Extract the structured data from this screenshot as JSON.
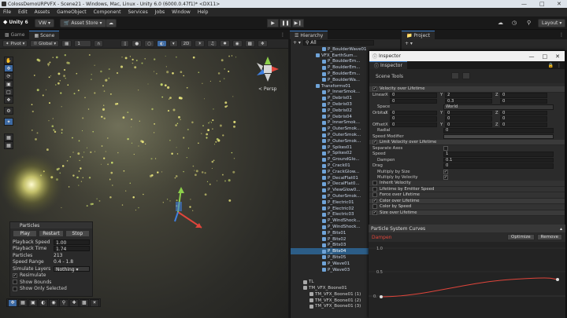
{
  "window": {
    "title": "ColossDemoURPVFX - Scene21 - Windows, Mac, Linux - Unity 6.0 (6000.0.47f1)* <DX11>"
  },
  "menu": [
    "File",
    "Edit",
    "Assets",
    "GameObject",
    "Component",
    "Services",
    "Jobs",
    "Window",
    "Help"
  ],
  "toolbar": {
    "unity_label": "Unity 6",
    "account": "VW",
    "asset_store": "Asset Store",
    "layout": "Layout"
  },
  "tabs": {
    "game": "Game",
    "scene": "Scene",
    "hierarchy": "Hierarchy",
    "project": "Project"
  },
  "scenebar": {
    "pivot": "Pivot",
    "global": "Global",
    "snap": "1",
    "zoom": "2D",
    "persp": "< Persp"
  },
  "particles_panel": {
    "title": "Particles",
    "play": "Play",
    "restart": "Restart",
    "stop": "Stop",
    "rows": [
      {
        "label": "Playback Speed",
        "value": "1.00"
      },
      {
        "label": "Playback Time",
        "value": "1.74"
      },
      {
        "label": "Particles",
        "value": "213"
      },
      {
        "label": "Speed Range",
        "value": "0.4 - 1.8"
      },
      {
        "label": "Simulate Layers",
        "value": "Nothing"
      }
    ],
    "checks": [
      {
        "label": "Resimulate",
        "checked": true
      },
      {
        "label": "Show Bounds",
        "checked": false
      },
      {
        "label": "Show Only Selected",
        "checked": false
      }
    ]
  },
  "hierarchy": {
    "search_placeholder": "All",
    "items": [
      {
        "name": "P_BoulderWave01",
        "indent": 4,
        "type": "prefab"
      },
      {
        "name": "VFX_EarthSum...",
        "indent": 3,
        "type": "prefab"
      },
      {
        "name": "P_BoulderEm...",
        "indent": 4,
        "type": "prefab"
      },
      {
        "name": "P_BoulderEm...",
        "indent": 4,
        "type": "prefab"
      },
      {
        "name": "P_BoulderEm...",
        "indent": 4,
        "type": "prefab"
      },
      {
        "name": "P_BoulderWa...",
        "indent": 4,
        "type": "prefab"
      },
      {
        "name": "Transforms01",
        "indent": 3,
        "type": "prefab"
      },
      {
        "name": "P_InnerSmok...",
        "indent": 4,
        "type": "prefab"
      },
      {
        "name": "P_Debris01",
        "indent": 4,
        "type": "prefab"
      },
      {
        "name": "P_Debris03",
        "indent": 4,
        "type": "prefab"
      },
      {
        "name": "P_Debris02",
        "indent": 4,
        "type": "prefab"
      },
      {
        "name": "P_Debris04",
        "indent": 4,
        "type": "prefab"
      },
      {
        "name": "P_InnerSmok...",
        "indent": 4,
        "type": "prefab"
      },
      {
        "name": "P_OuterSmok...",
        "indent": 4,
        "type": "prefab"
      },
      {
        "name": "P_OuterSmok...",
        "indent": 4,
        "type": "prefab"
      },
      {
        "name": "P_OuterSmok...",
        "indent": 4,
        "type": "prefab"
      },
      {
        "name": "P_Spikes01",
        "indent": 4,
        "type": "prefab"
      },
      {
        "name": "P_Spikes02",
        "indent": 4,
        "type": "prefab"
      },
      {
        "name": "P_GroundGlo...",
        "indent": 4,
        "type": "prefab"
      },
      {
        "name": "P_Crack01",
        "indent": 4,
        "type": "prefab"
      },
      {
        "name": "P_CrackGlow...",
        "indent": 4,
        "type": "prefab"
      },
      {
        "name": "P_DecalFlat01",
        "indent": 4,
        "type": "prefab"
      },
      {
        "name": "P_DecalFlat0...",
        "indent": 4,
        "type": "prefab"
      },
      {
        "name": "P_ViewGlow0...",
        "indent": 4,
        "type": "prefab"
      },
      {
        "name": "P_OuterSmok...",
        "indent": 4,
        "type": "prefab"
      },
      {
        "name": "P_Electric01",
        "indent": 4,
        "type": "prefab"
      },
      {
        "name": "P_Electric02",
        "indent": 4,
        "type": "prefab"
      },
      {
        "name": "P_Electric03",
        "indent": 4,
        "type": "prefab"
      },
      {
        "name": "P_WindShock...",
        "indent": 4,
        "type": "prefab"
      },
      {
        "name": "P_WindShock...",
        "indent": 4,
        "type": "prefab"
      },
      {
        "name": "P_Bits01",
        "indent": 4,
        "type": "prefab"
      },
      {
        "name": "P_Bits02",
        "indent": 4,
        "type": "prefab"
      },
      {
        "name": "P_Bits03",
        "indent": 4,
        "type": "prefab"
      },
      {
        "name": "P_Bits04",
        "indent": 4,
        "type": "prefab",
        "selected": true
      },
      {
        "name": "P_Bits05",
        "indent": 4,
        "type": "prefab"
      },
      {
        "name": "P_Wave01",
        "indent": 4,
        "type": "prefab"
      },
      {
        "name": "P_Wave03",
        "indent": 4,
        "type": "prefab"
      },
      {
        "name": "",
        "indent": 0,
        "type": "gap"
      },
      {
        "name": "TL",
        "indent": 1,
        "type": "object"
      },
      {
        "name": "TM_VFX_Boone01",
        "indent": 1,
        "type": "object"
      },
      {
        "name": "TM_VFX_Boone01 (1)",
        "indent": 2,
        "type": "object"
      },
      {
        "name": "TM_VFX_Boone01 (2)",
        "indent": 2,
        "type": "object"
      },
      {
        "name": "TM_VFX_Boone01 (3)",
        "indent": 2,
        "type": "object"
      }
    ]
  },
  "inspector": {
    "window_title": "Inspector",
    "tab": "Inspector",
    "scene_tools": "Scene Tools",
    "velocity_module": "Velocity over Lifetime",
    "linear": {
      "label": "Linear",
      "x": "0",
      "y": "2",
      "z": "0",
      "x2": "0",
      "y2": "0.3",
      "z2": "0"
    },
    "space": {
      "label": "Space",
      "value": "World"
    },
    "orbital": {
      "label": "Orbital",
      "x": "0",
      "y": "0",
      "z": "0",
      "x2": "0",
      "y2": "0",
      "z2": "0"
    },
    "offset": {
      "label": "Offset",
      "x": "0",
      "y": "0",
      "z": "0"
    },
    "radial": {
      "label": "Radial",
      "value": "0"
    },
    "speed_modifier": "Speed Modifier",
    "limit_module": "Limit Velocity over Lifetime",
    "separate_axes": "Separate Axes",
    "speed": {
      "label": "Speed",
      "value": "1"
    },
    "dampen": {
      "label": "Dampen",
      "value": "0.1"
    },
    "drag": {
      "label": "Drag",
      "value": "0"
    },
    "mult_size": "Multiply by Size",
    "mult_velocity": "Multiply by Velocity",
    "modules": [
      {
        "label": "Inherit Velocity",
        "on": false
      },
      {
        "label": "Lifetime by Emitter Speed",
        "on": false
      },
      {
        "label": "Force over Lifetime",
        "on": false
      },
      {
        "label": "Color over Lifetime",
        "on": true
      },
      {
        "label": "Color by Speed",
        "on": false
      },
      {
        "label": "Size over Lifetime",
        "on": true
      }
    ]
  },
  "curves": {
    "title": "Particle System Curves",
    "label": "Dampen",
    "optimize": "Optimize",
    "remove": "Remove",
    "y_top": "1.0",
    "y_mid": "0.5",
    "y_bottom": "0."
  }
}
